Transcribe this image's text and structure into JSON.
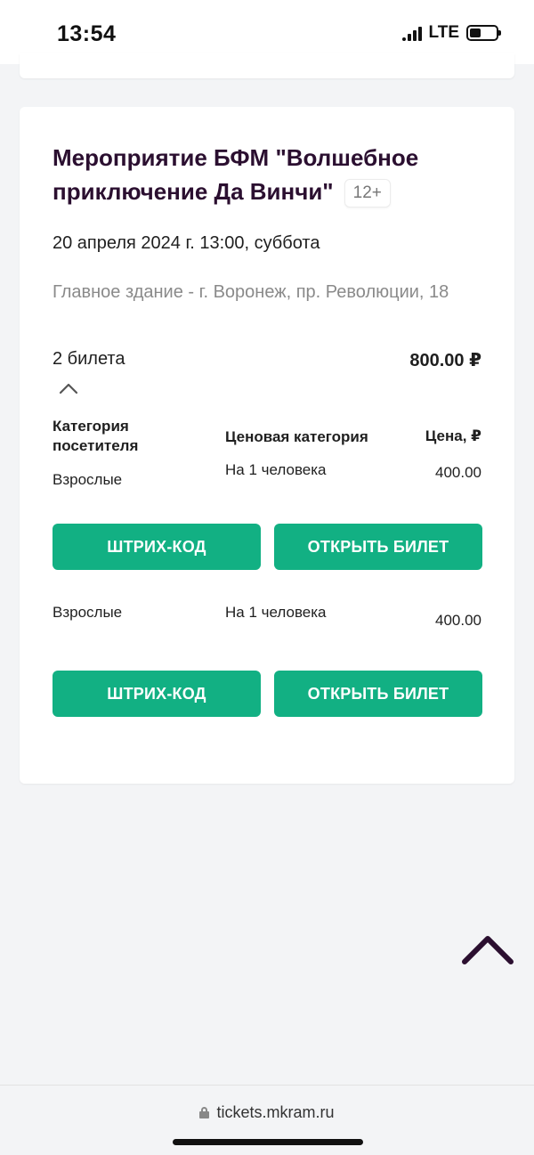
{
  "status_bar": {
    "time": "13:54",
    "network": "LTE"
  },
  "event": {
    "title": "Мероприятие БФМ \"Волшебное приключение Да Винчи\"",
    "age": "12+",
    "date": "20 апреля 2024 г. 13:00, суббота",
    "place": "Главное здание - г. Воронеж, пр. Революции, 18"
  },
  "order": {
    "tickets_count": "2 билета",
    "total": "800.00 ₽"
  },
  "table": {
    "headers": {
      "visitor": "Категория посетителя",
      "price_category": "Ценовая категория",
      "price": "Цена, ₽"
    },
    "tickets": [
      {
        "visitor": "Взрослые",
        "price_category": "На 1 человека",
        "price": "400.00",
        "barcode_label": "ШТРИХ-КОД",
        "open_label": "ОТКРЫТЬ БИЛЕТ"
      },
      {
        "visitor": "Взрослые",
        "price_category": "На 1 человека",
        "price": "400.00",
        "barcode_label": "ШТРИХ-КОД",
        "open_label": "ОТКРЫТЬ БИЛЕТ"
      }
    ]
  },
  "browser": {
    "url": "tickets.mkram.ru"
  },
  "colors": {
    "accent": "#12b083",
    "title": "#2b0f30",
    "muted": "#8a8a8a"
  }
}
